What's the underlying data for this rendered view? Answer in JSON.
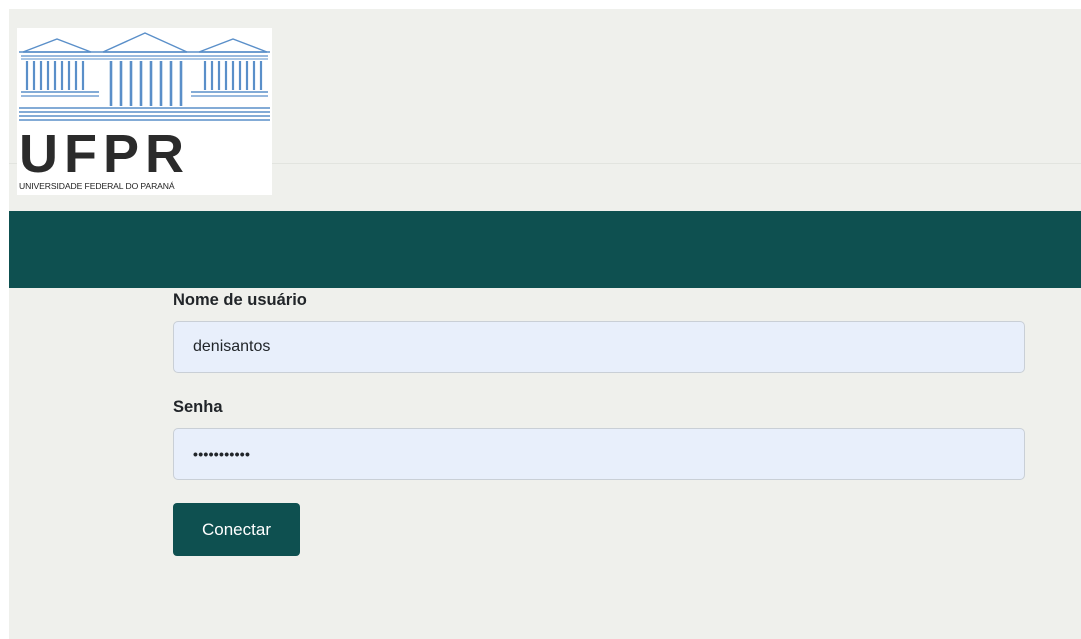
{
  "header": {
    "logo": {
      "name": "ufpr-logo",
      "wordmark": "UFPR",
      "caption": "UNIVERSIDADE FEDERAL DO PARANÁ"
    }
  },
  "colors": {
    "page_background": "#eff0ec",
    "banner": "#0e5050",
    "button": "#0e5050",
    "input_background": "#e8effb"
  },
  "login": {
    "username_label": "Nome de usuário",
    "username_value": "denisantos",
    "password_label": "Senha",
    "password_value": "•••••••••••",
    "submit_label": "Conectar"
  }
}
